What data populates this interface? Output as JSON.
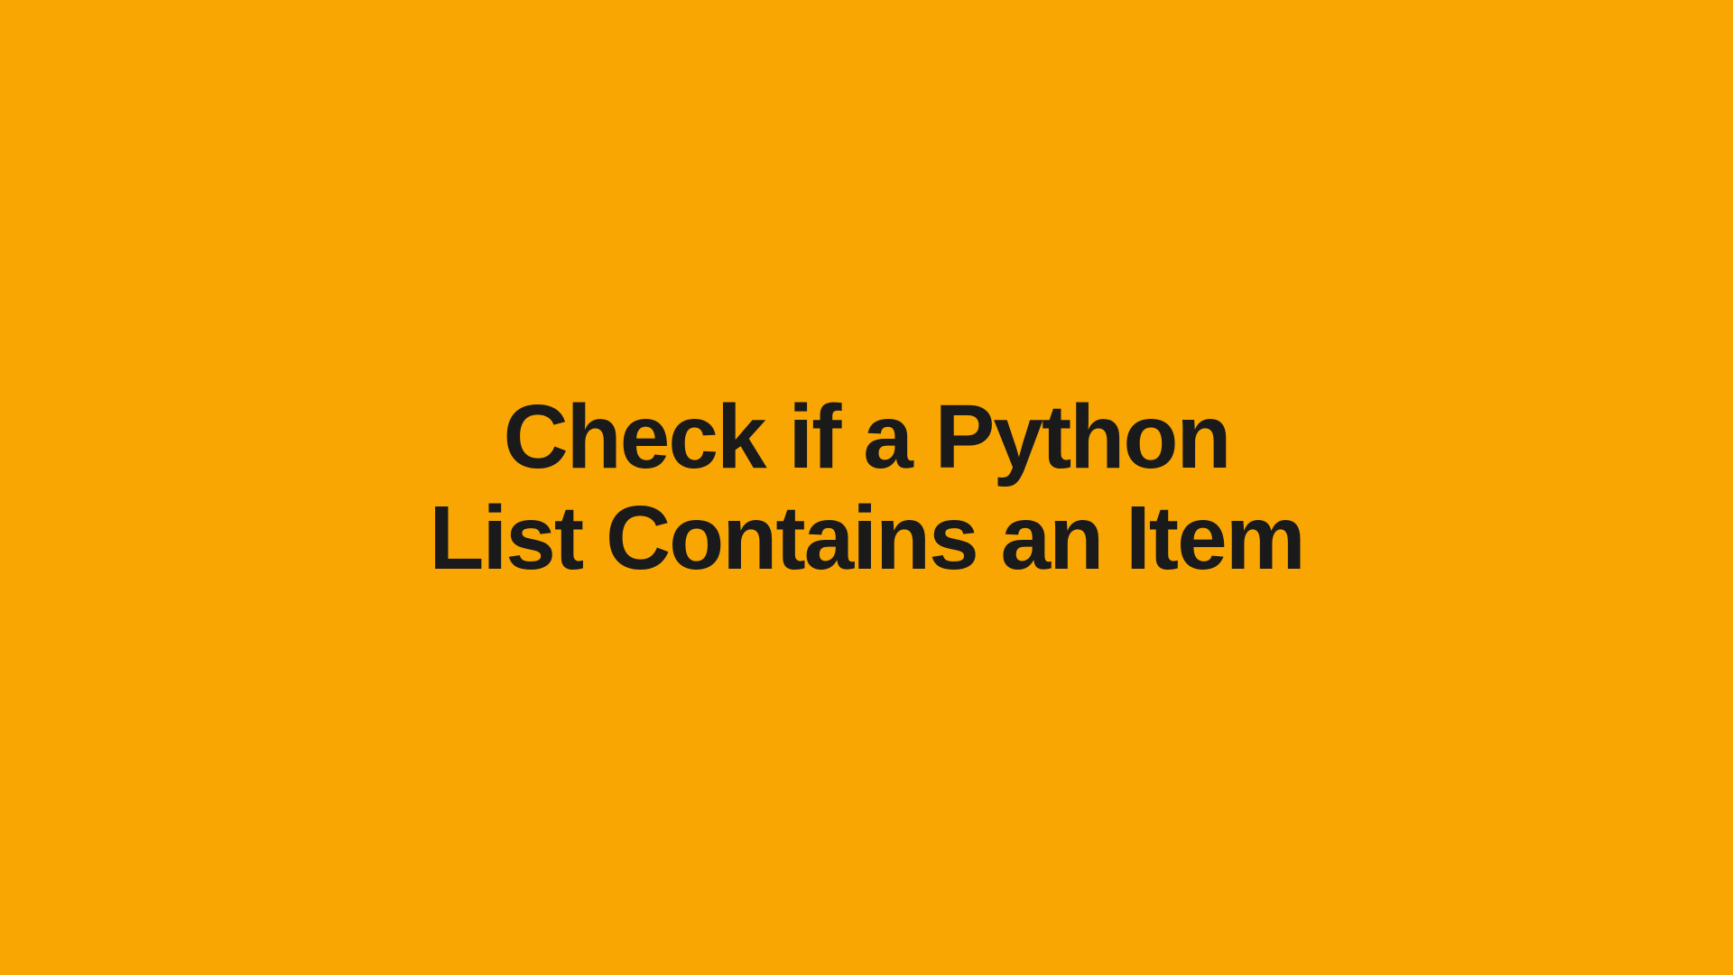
{
  "title": {
    "line1": "Check if a Python",
    "line2": "List Contains an Item"
  },
  "colors": {
    "background": "#F9A602",
    "text": "#1a1a1a"
  }
}
